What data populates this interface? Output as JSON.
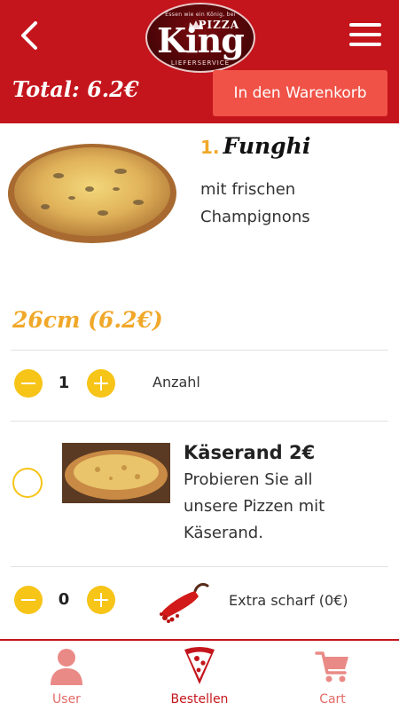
{
  "header": {
    "logo": {
      "tagline": "Essen wie ein König, bei",
      "brand_top": "PIZZA",
      "brand_main": "King",
      "brand_sub": "LIEFERSERVICE"
    },
    "total_label": "Total: 6.2€",
    "cart_button_label": "In den Warenkorb"
  },
  "product": {
    "number": "1.",
    "name": "Funghi",
    "description_line1": "mit frischen",
    "description_line2": "Champignons",
    "size_price": "26cm (6.2€)",
    "quantity": "1",
    "quantity_label": "Anzahl"
  },
  "extras": [
    {
      "title": "Käserand 2€",
      "description_lines": [
        "Probieren Sie all",
        "unsere Pizzen mit",
        "Käserand."
      ],
      "selected": false
    },
    {
      "quantity": "0",
      "label": "Extra scharf (0€)"
    }
  ],
  "bottom_nav": [
    {
      "label": "User",
      "icon": "user-icon"
    },
    {
      "label": "Bestellen",
      "icon": "pizza-slice-icon"
    },
    {
      "label": "Cart",
      "icon": "cart-icon"
    }
  ],
  "colors": {
    "brand_red": "#c4151c",
    "button_red": "#f05247",
    "accent_yellow": "#f7c418",
    "accent_orange": "#f0a82a"
  }
}
